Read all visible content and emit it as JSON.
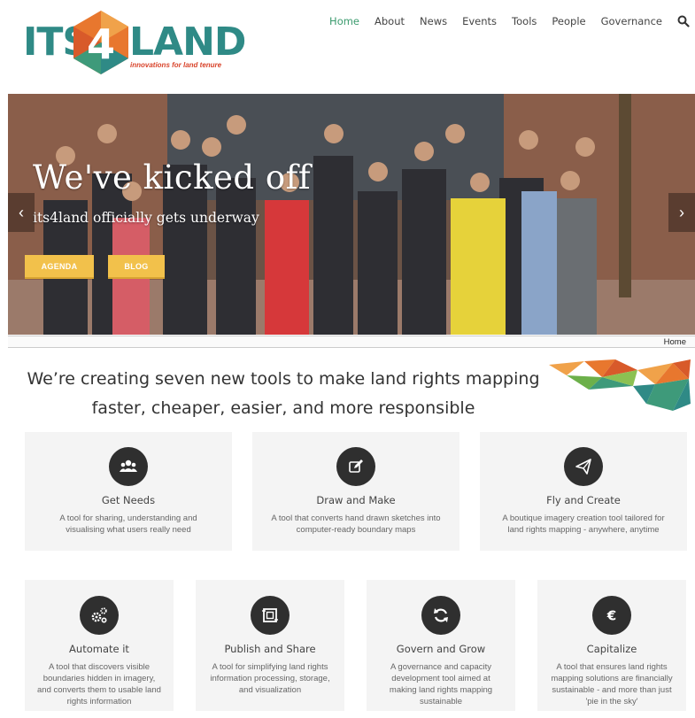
{
  "brand": {
    "logo_left": "ITS",
    "logo_number": "4",
    "logo_right": "LAND",
    "tagline": "innovations for land tenure"
  },
  "nav": {
    "items": [
      "Home",
      "About",
      "News",
      "Events",
      "Tools",
      "People",
      "Governance"
    ],
    "active": "Home",
    "search_icon": "search-icon"
  },
  "hero": {
    "title": "We've kicked off",
    "subtitle": "its4land officially gets underway",
    "buttons": [
      "AGENDA",
      "BLOG"
    ],
    "prev_icon": "chevron-left-icon",
    "next_icon": "chevron-right-icon"
  },
  "breadcrumb": "Home",
  "intro": {
    "line1": "We’re creating seven new tools to make land rights mapping",
    "line2": "faster, cheaper, easier, and more responsible"
  },
  "tools": [
    {
      "icon": "users-icon",
      "title": "Get Needs",
      "desc": "A tool for sharing, understanding and visualising what users really need"
    },
    {
      "icon": "edit-icon",
      "title": "Draw and Make",
      "desc": "A tool that converts hand drawn sketches into computer-ready boundary maps"
    },
    {
      "icon": "paper-plane-icon",
      "title": "Fly and Create",
      "desc": "A boutique imagery creation tool tailored for land rights mapping - anywhere, anytime"
    },
    {
      "icon": "cogs-icon",
      "title": "Automate it",
      "desc": "A tool that discovers visible boundaries hidden in imagery, and converts them to usable land rights information"
    },
    {
      "icon": "frame-icon",
      "title": "Publish and Share",
      "desc": "A tool for simplifying land rights information processing, storage, and visualization"
    },
    {
      "icon": "refresh-icon",
      "title": "Govern and Grow",
      "desc": "A governance and capacity development tool aimed at making land rights mapping sustainable"
    },
    {
      "icon": "euro-icon",
      "title": "Capitalize",
      "desc": "A tool that ensures land rights mapping solutions are financially sustainable - and more than just 'pie in the sky'"
    }
  ],
  "colors": {
    "brand_teal": "#2f8a86",
    "brand_orange": "#e8772e",
    "nav_active": "#3b9b6e",
    "button_yellow": "#f2c14b",
    "card_bg": "#f4f4f4",
    "icon_circle": "#2f2f2f"
  }
}
